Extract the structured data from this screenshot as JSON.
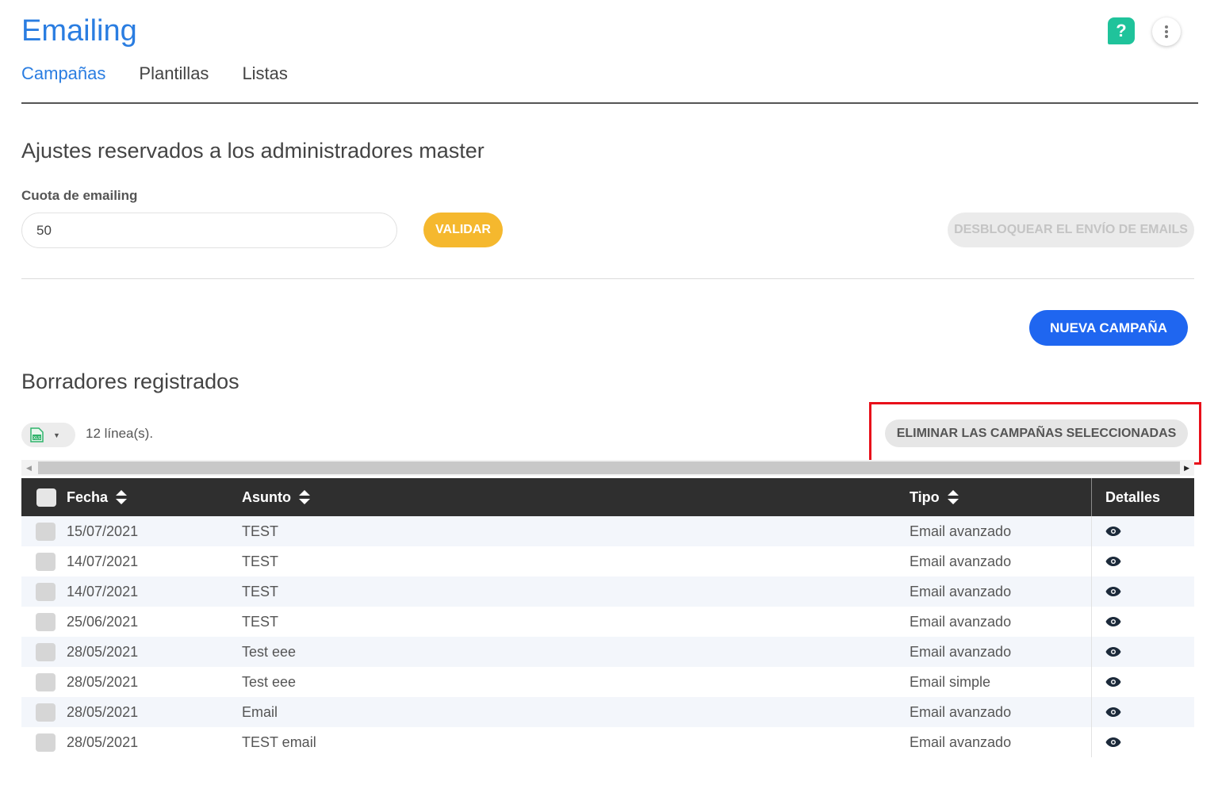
{
  "header": {
    "title": "Emailing",
    "help_icon": "question-icon",
    "more_icon": "more-vertical-icon"
  },
  "tabs": [
    {
      "label": "Campañas"
    },
    {
      "label": "Plantillas"
    },
    {
      "label": "Listas"
    }
  ],
  "admin": {
    "title": "Ajustes reservados a los administradores master",
    "quota_label": "Cuota de emailing",
    "quota_value": "50",
    "validate_label": "VALIDAR",
    "unlock_label": "DESBLOQUEAR EL ENVÍO DE EMAILS"
  },
  "new_campaign_label": "NUEVA CAMPAÑA",
  "drafts": {
    "title": "Borradores registrados",
    "count_text": "12 línea(s).",
    "delete_label": "ELIMINAR LAS CAMPAÑAS SELECCIONADAS",
    "export_icon": "spreadsheet-icon"
  },
  "table": {
    "columns": {
      "date": "Fecha",
      "subject": "Asunto",
      "type": "Tipo",
      "details": "Detalles"
    },
    "rows": [
      {
        "date": "15/07/2021",
        "subject": "TEST",
        "type": "Email avanzado"
      },
      {
        "date": "14/07/2021",
        "subject": "TEST",
        "type": "Email avanzado"
      },
      {
        "date": "14/07/2021",
        "subject": "TEST",
        "type": "Email avanzado"
      },
      {
        "date": "25/06/2021",
        "subject": "TEST",
        "type": "Email avanzado"
      },
      {
        "date": "28/05/2021",
        "subject": "Test eee",
        "type": "Email avanzado"
      },
      {
        "date": "28/05/2021",
        "subject": "Test eee",
        "type": "Email simple"
      },
      {
        "date": "28/05/2021",
        "subject": "Email",
        "type": "Email avanzado"
      },
      {
        "date": "28/05/2021",
        "subject": "TEST email",
        "type": "Email avanzado"
      }
    ]
  },
  "colors": {
    "accent_blue": "#2a7de1",
    "primary_button": "#1f66f0",
    "validate_button": "#f5b82e",
    "help_green": "#1fc39b",
    "highlight_red": "#e8101a"
  }
}
